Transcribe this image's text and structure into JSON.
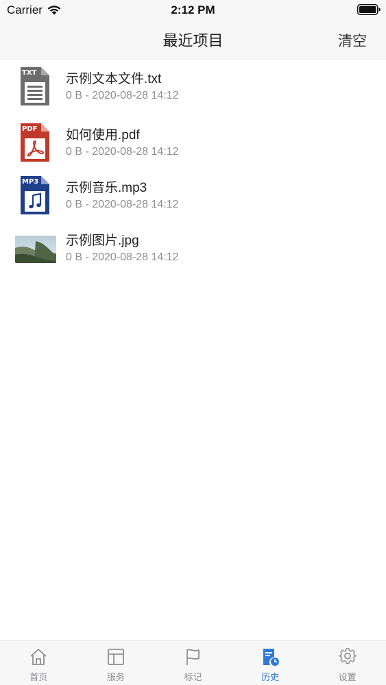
{
  "status_bar": {
    "carrier": "Carrier",
    "time": "2:12 PM"
  },
  "nav": {
    "title": "最近项目",
    "clear_label": "清空"
  },
  "files": [
    {
      "name": "示例文本文件.txt",
      "meta": "0 B - 2020-08-28 14:12",
      "icon": "txt-file-icon",
      "badge": "TXT",
      "color": "#6d6d6d"
    },
    {
      "name": "如何使用.pdf",
      "meta": "0 B - 2020-08-28 14:12",
      "icon": "pdf-file-icon",
      "badge": "PDF",
      "color": "#c0392b"
    },
    {
      "name": "示例音乐.mp3",
      "meta": "0 B - 2020-08-28 14:12",
      "icon": "mp3-file-icon",
      "badge": "MP3",
      "color": "#1f3f8a"
    },
    {
      "name": "示例图片.jpg",
      "meta": "0 B - 2020-08-28 14:12",
      "icon": "image-thumbnail"
    }
  ],
  "tabs": [
    {
      "label": "首页",
      "icon": "home-icon"
    },
    {
      "label": "服务",
      "icon": "layout-icon"
    },
    {
      "label": "标记",
      "icon": "flag-icon"
    },
    {
      "label": "历史",
      "icon": "history-icon",
      "active": true
    },
    {
      "label": "设置",
      "icon": "gear-icon"
    }
  ],
  "colors": {
    "accent": "#2e7ad6",
    "inactive": "#8e8e93",
    "bar_background": "#f7f7f7"
  }
}
